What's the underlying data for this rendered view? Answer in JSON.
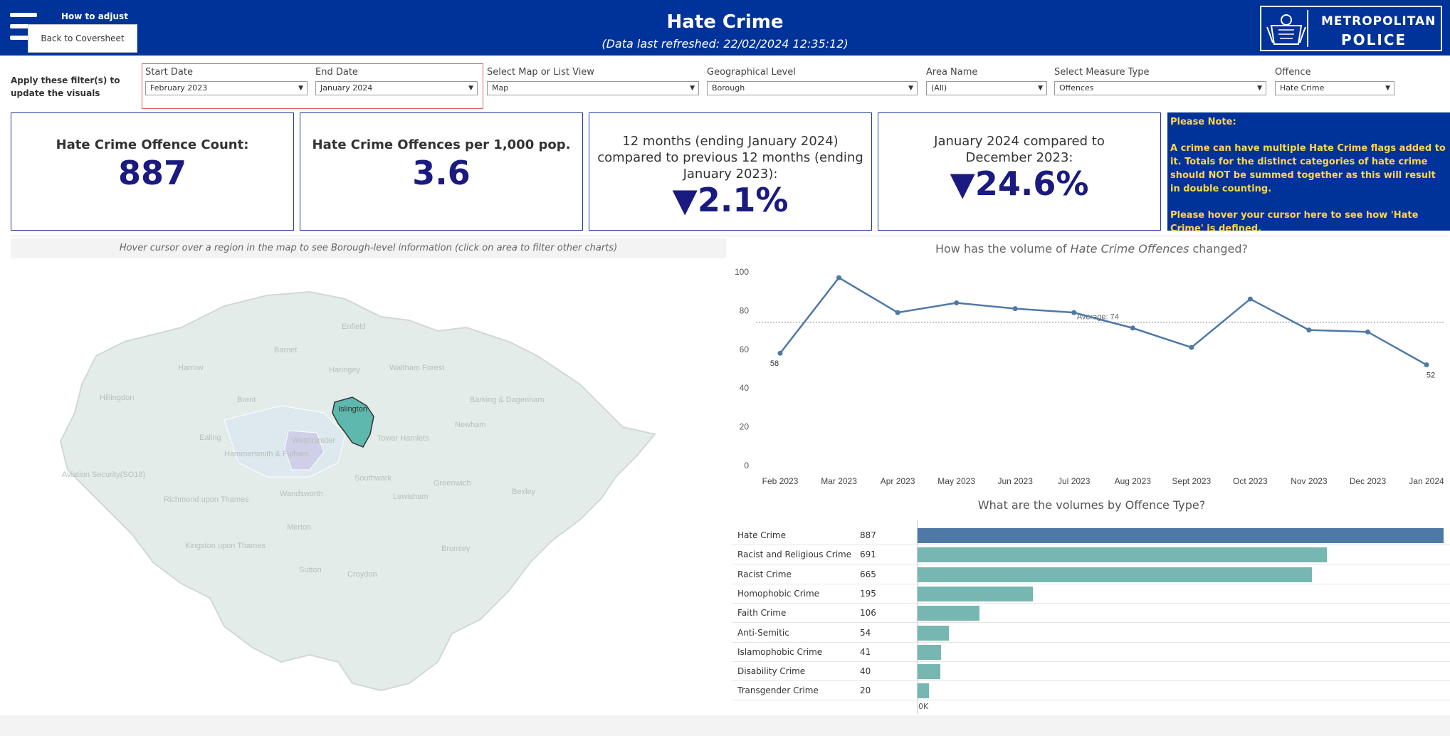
{
  "header": {
    "how_to": "How to adjust",
    "back_button": "Back to Coversheet",
    "title": "Hate Crime",
    "subtitle": "(Data last refreshed: 22/02/2024 12:35:12)",
    "logo_line1": "METROPOLITAN",
    "logo_line2": "POLICE",
    "background_color": "#003399"
  },
  "filters": {
    "apply_label": "Apply these filter(s) to update the visuals",
    "start_date": {
      "label": "Start Date",
      "value": "February 2023"
    },
    "end_date": {
      "label": "End Date",
      "value": "January 2024"
    },
    "map_or_list": {
      "label": "Select Map or List View",
      "value": "Map"
    },
    "geo_level": {
      "label": "Geographical Level",
      "value": "Borough"
    },
    "area_name": {
      "label": "Area Name",
      "value": "(All)"
    },
    "measure_type": {
      "label": "Select Measure Type",
      "value": "Offences"
    },
    "offence": {
      "label": "Offence",
      "value": "Hate Crime"
    }
  },
  "kpis": {
    "count": {
      "title": "Hate Crime Offence Count:",
      "value": "887"
    },
    "per_1000": {
      "title": "Hate Crime Offences per 1,000 pop.",
      "value": "3.6"
    },
    "yoy": {
      "title": "12 months (ending January 2024) compared to previous 12 months (ending January 2023):",
      "value": "▼2.1%"
    },
    "mom": {
      "title": "January 2024 compared to December 2023:",
      "value": "▼24.6%"
    }
  },
  "note": {
    "heading": "Please Note:",
    "para1": "A crime can have multiple Hate Crime flags added to it. Totals for the distinct categories of hate crime should NOT be summed together as this will result in double counting.",
    "para2": "Please hover your cursor here to see how 'Hate Crime' is defined."
  },
  "map": {
    "hint": "Hover cursor over a region in the map to see Borough-level information (click on area to filter other charts)",
    "selected_borough": "Islington",
    "boroughs": [
      "Enfield",
      "Barnet",
      "Harrow",
      "Haringey",
      "Waltham Forest",
      "Hillingdon",
      "Brent",
      "Islington",
      "Barking & Dagenham",
      "Newham",
      "Ealing",
      "Westminster",
      "Tower Hamlets",
      "Hammersmith & Fulham",
      "Aviation Security(SO18)",
      "Southwark",
      "Greenwich",
      "Bexley",
      "Richmond upon Thames",
      "Wandsworth",
      "Lewisham",
      "Merton",
      "Kingston upon Thames",
      "Bromley",
      "Sutton",
      "Croydon"
    ],
    "fill_color": "#e3ece9",
    "selected_color": "#5fb8ad"
  },
  "line_chart": {
    "title_prefix": "How has the volume of ",
    "title_italic": "Hate Crime Offences",
    "title_suffix": " changed?",
    "average_label": "Average: 74"
  },
  "bar_chart": {
    "title": "What are the volumes by Offence Type?",
    "axis_label": "0K"
  },
  "chart_data": [
    {
      "type": "line",
      "title": "How has the volume of Hate Crime Offences changed?",
      "x": [
        "Feb 2023",
        "Mar 2023",
        "Apr 2023",
        "May 2023",
        "Jun 2023",
        "Jul 2023",
        "Aug 2023",
        "Sept 2023",
        "Oct 2023",
        "Nov 2023",
        "Dec 2023",
        "Jan 2024"
      ],
      "series": [
        {
          "values": [
            58,
            97,
            79,
            84,
            81,
            79,
            71,
            61,
            86,
            70,
            69,
            52
          ]
        }
      ],
      "point_labels": {
        "0": "58",
        "11": "52"
      },
      "average": 74,
      "ylim": [
        0,
        100
      ],
      "yticks": [
        0,
        20,
        40,
        60,
        80,
        100
      ],
      "color": "#4e79a7"
    },
    {
      "type": "bar",
      "title": "What are the volumes by Offence Type?",
      "categories": [
        "Hate Crime",
        "Racist and Religious Crime",
        "Racist Crime",
        "Homophobic Crime",
        "Faith Crime",
        "Anti-Semitic",
        "Islamophobic Crime",
        "Disability Crime",
        "Transgender Crime"
      ],
      "values": [
        887,
        691,
        665,
        195,
        106,
        54,
        41,
        40,
        20
      ],
      "highlight_color": "#4e79a7",
      "color": "#76b7b2"
    }
  ]
}
